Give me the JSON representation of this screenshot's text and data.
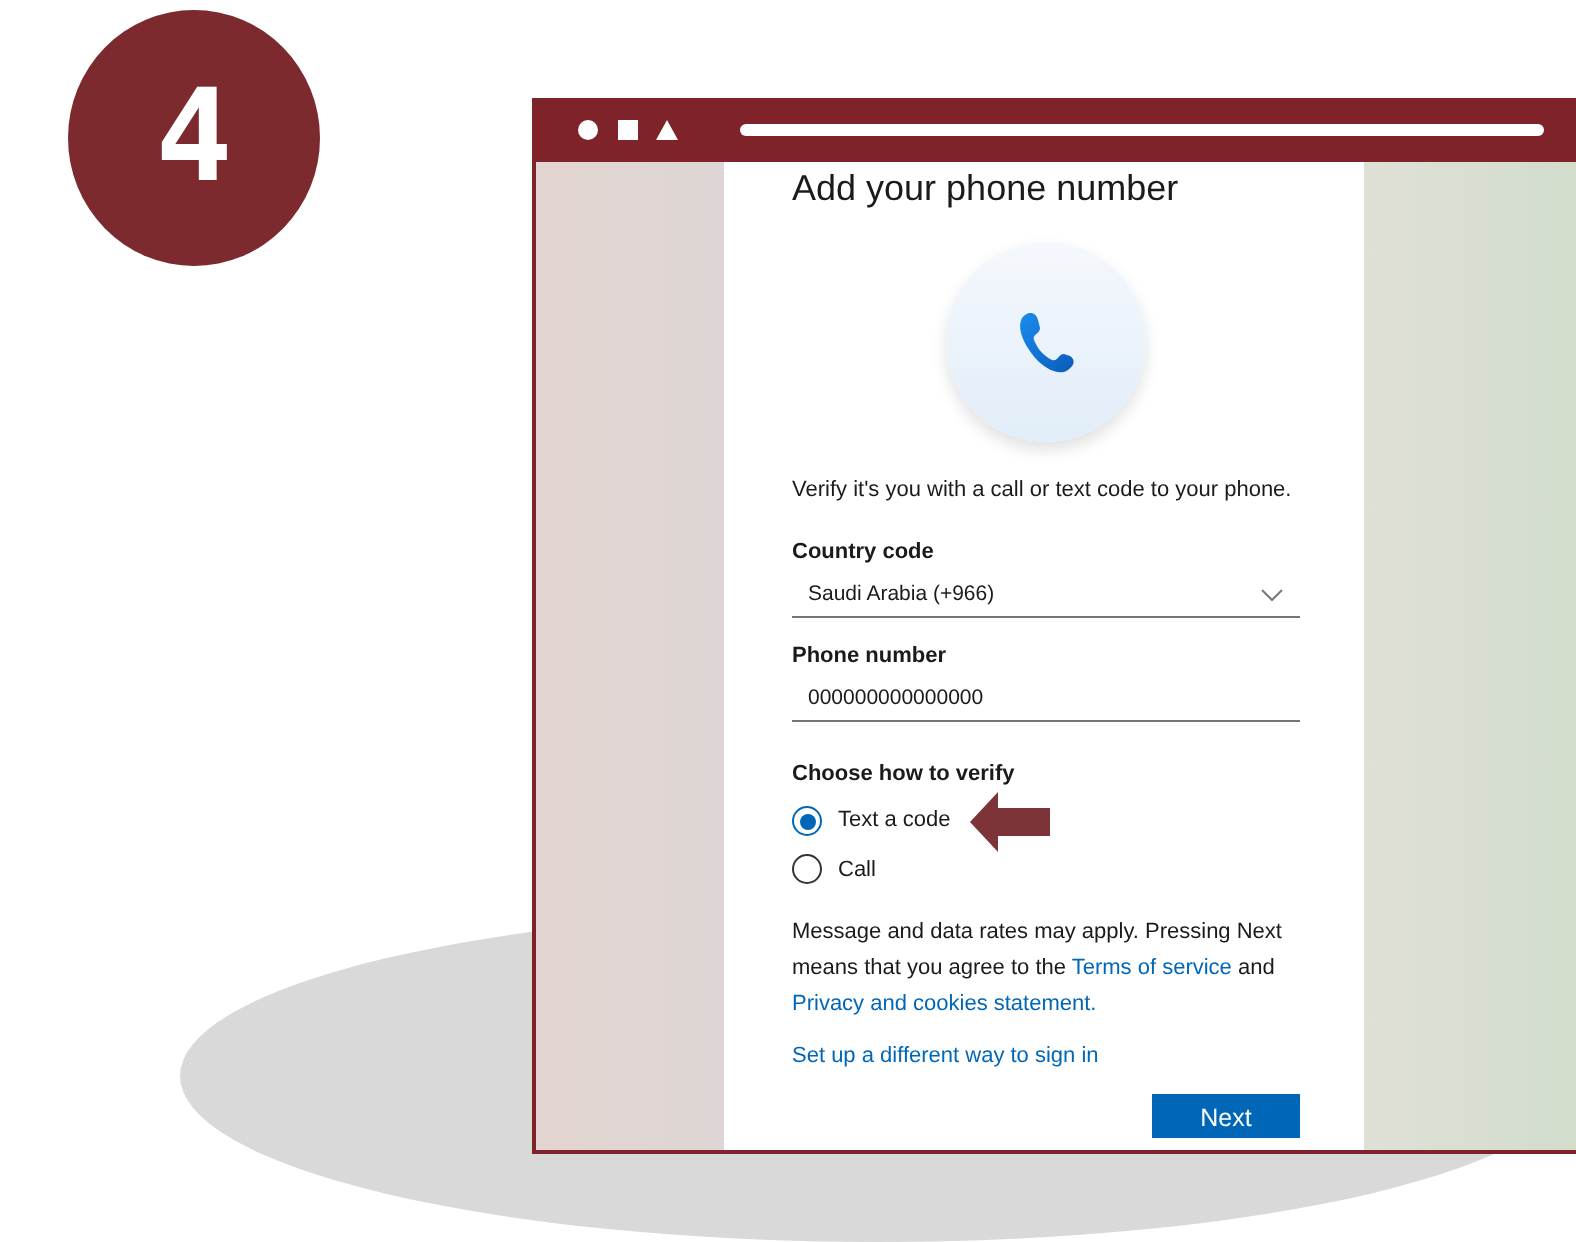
{
  "step_number": "4",
  "browser": {
    "page": {
      "title": "Add your phone number",
      "intro": "Verify it's you with a call or text code to your phone.",
      "country_code": {
        "label": "Country code",
        "value": "Saudi Arabia (+966)"
      },
      "phone_number": {
        "label": "Phone number",
        "value": "000000000000000"
      },
      "verify": {
        "label": "Choose how to verify",
        "options": [
          {
            "label": "Text a code",
            "selected": true
          },
          {
            "label": "Call",
            "selected": false
          }
        ]
      },
      "message": [
        {
          "kind": "text",
          "text": "Message and data rates may apply. Pressing Next means that you agree to the "
        },
        {
          "kind": "link",
          "text": "Terms of service"
        },
        {
          "kind": "text",
          "text": " and "
        },
        {
          "kind": "link",
          "text": "Privacy and cookies statement."
        }
      ],
      "alternative_link": "Set up a different way to sign in",
      "next_button": "Next"
    }
  }
}
